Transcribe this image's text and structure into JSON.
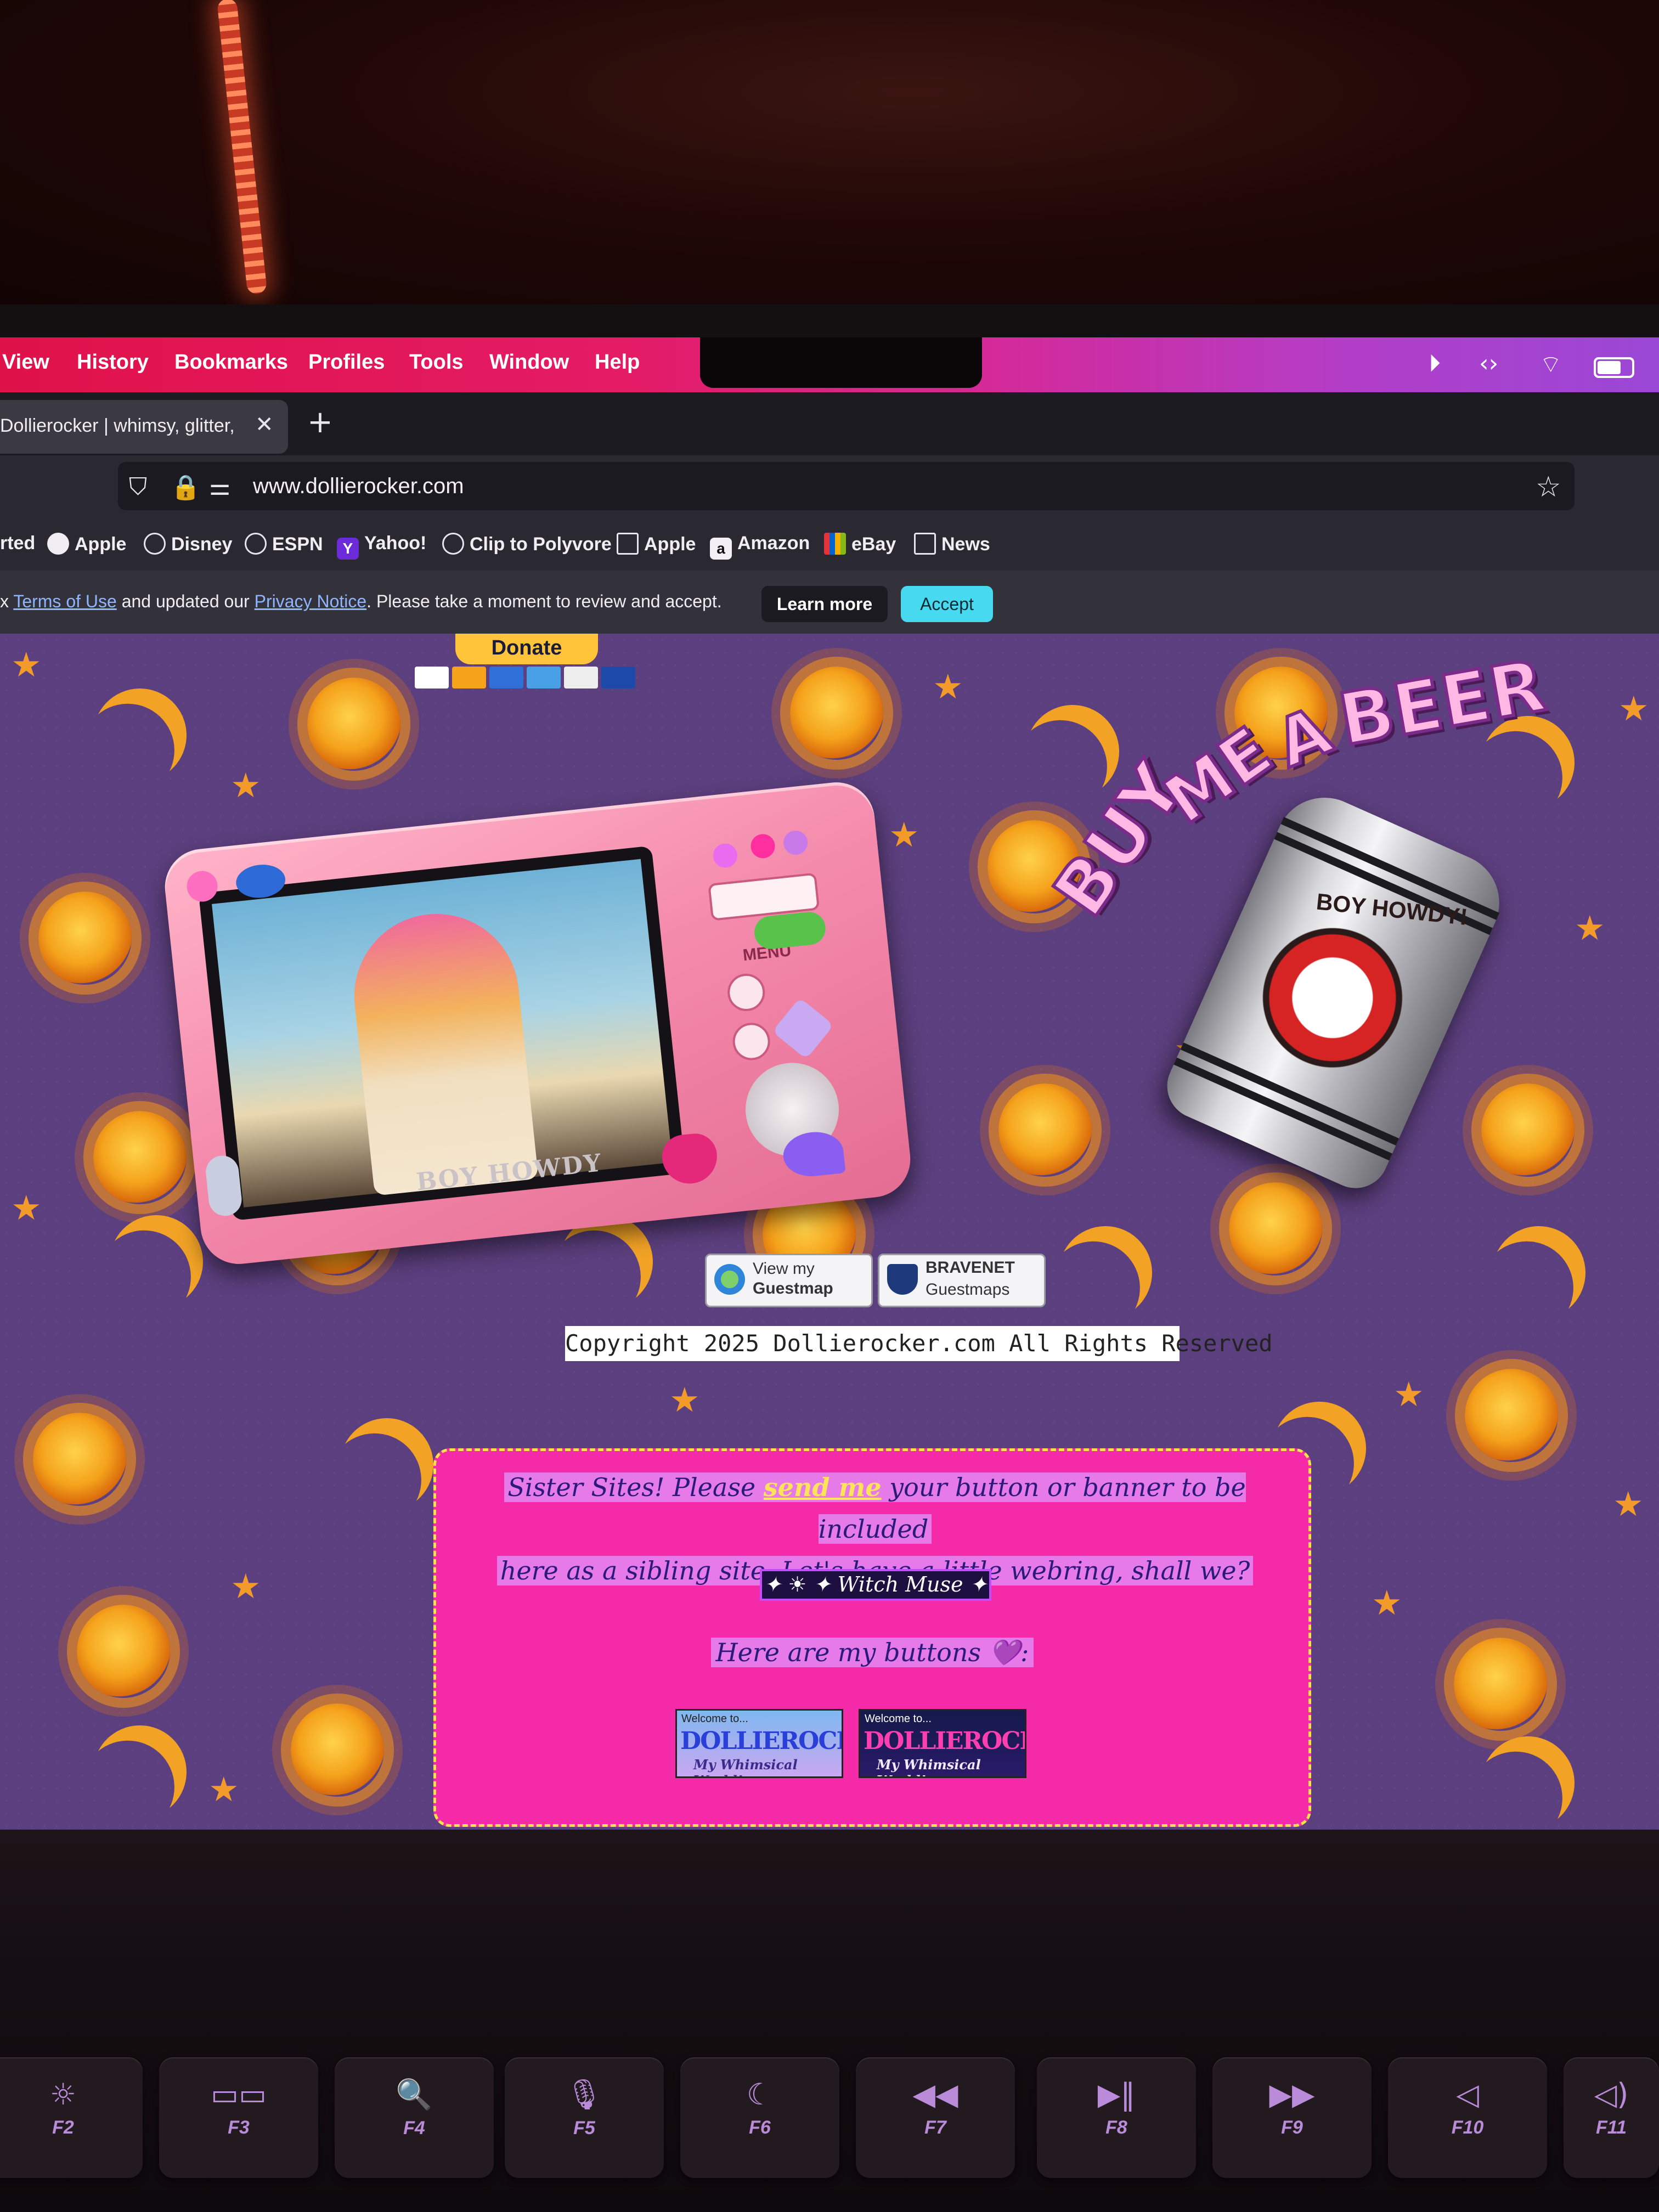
{
  "menubar": {
    "items": [
      "View",
      "History",
      "Bookmarks",
      "Profiles",
      "Tools",
      "Window",
      "Help"
    ]
  },
  "tab": {
    "title": "Dollierocker | whimsy, glitter, roc",
    "close": "✕",
    "new_tab": "+"
  },
  "address_bar": {
    "url": "www.dollierocker.com"
  },
  "bookmarks": [
    {
      "label": "rted",
      "icon": "none"
    },
    {
      "label": "Apple",
      "icon": "apple-icon"
    },
    {
      "label": "Disney",
      "icon": "globe-icon"
    },
    {
      "label": "ESPN",
      "icon": "globe-icon"
    },
    {
      "label": "Yahoo!",
      "icon": "yahoo-icon"
    },
    {
      "label": "Clip to Polyvore",
      "icon": "globe-icon"
    },
    {
      "label": "Apple",
      "icon": "folder-icon"
    },
    {
      "label": "Amazon",
      "icon": "amazon-icon"
    },
    {
      "label": "eBay",
      "icon": "ebay-icon"
    },
    {
      "label": "News",
      "icon": "folder-icon"
    }
  ],
  "notice": {
    "prefix": "x ",
    "terms": "Terms of Use",
    "middle": " and updated our ",
    "privacy": "Privacy Notice",
    "suffix": ". Please take a moment to review and accept.",
    "learn_more": "Learn more",
    "accept": "Accept"
  },
  "page": {
    "donate": "Donate",
    "camera_caption": "BOY HOWDY",
    "camera_menu": "MENU",
    "buy_me": [
      "BUY",
      "ME",
      "A",
      "BEER"
    ],
    "can_text": "BOY HOWDY!",
    "guestmap_line1": "View my",
    "guestmap_line2": "Guestmap",
    "bravenet_line1": "BRAVENET",
    "bravenet_line2": "Guestmaps",
    "copyright": "Copyright 2025 Dollierocker.com All Rights Reserved",
    "sister_text_1": "Sister Sites! Please ",
    "sister_link": "send me",
    "sister_text_2": " your button or banner to be included",
    "sister_text_3": "here as a sibling site. Let's have a little webring, shall we?",
    "witch_muse": "✦ ☀ ✦ Witch Muse ✦",
    "here_buttons": "Here are my buttons 💜:",
    "button_welcome": "Welcome to...",
    "button_site": "DOLLIEROCKER.COM",
    "button_tagline": "My Whimsical World!"
  },
  "keyboard": [
    {
      "icon": "☼",
      "label": "F2"
    },
    {
      "icon": "▭▭",
      "label": "F3"
    },
    {
      "icon": "🔍",
      "label": "F4"
    },
    {
      "icon": "🎙",
      "label": "F5"
    },
    {
      "icon": "☾",
      "label": "F6"
    },
    {
      "icon": "◀◀",
      "label": "F7"
    },
    {
      "icon": "▶‖",
      "label": "F8"
    },
    {
      "icon": "▶▶",
      "label": "F9"
    },
    {
      "icon": "◁",
      "label": "F10"
    },
    {
      "icon": "◁)",
      "label": "F11"
    }
  ],
  "colors": {
    "menubar_start": "#e0124a",
    "menubar_end": "#9a48d6",
    "accept_button": "#47d9ef",
    "sister_box": "#f52aa8",
    "sister_border": "#ffe14a",
    "page_bg": "#5c3f7e"
  }
}
